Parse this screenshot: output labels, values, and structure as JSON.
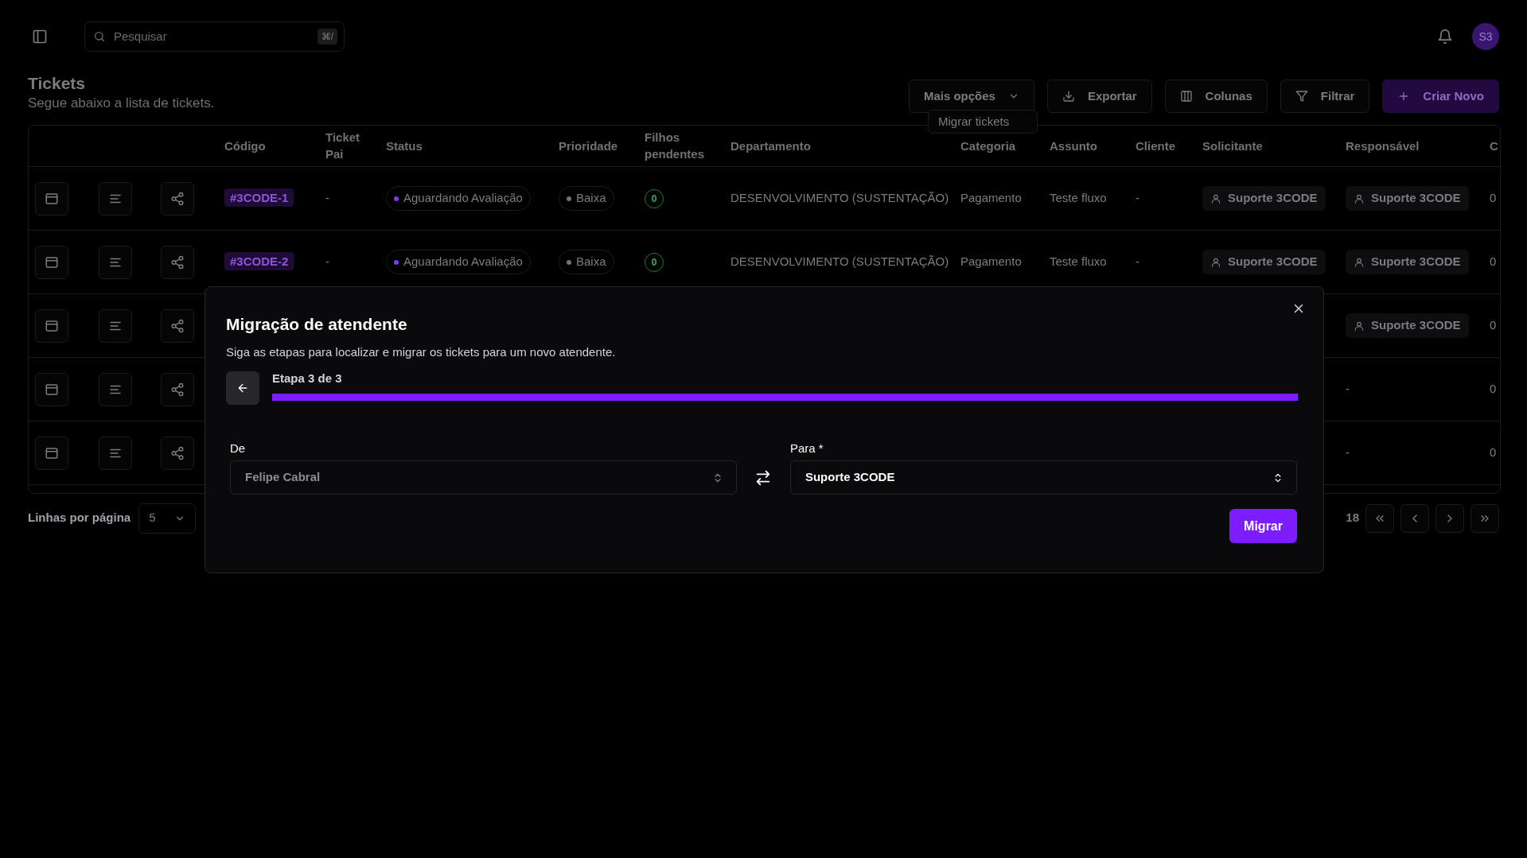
{
  "topbar": {
    "search": {
      "placeholder": "Pesquisar",
      "shortcut": "⌘/"
    },
    "avatar": "S3"
  },
  "header": {
    "title": "Tickets",
    "subtitle": "Segue abaixo a lista de tickets.",
    "buttons": [
      {
        "label": "Mais opções",
        "kind": "dropdown"
      },
      {
        "label": "Exportar",
        "kind": "export"
      },
      {
        "label": "Colunas",
        "kind": "columns"
      },
      {
        "label": "Filtrar",
        "kind": "filter"
      },
      {
        "label": "Criar Novo",
        "kind": "create"
      }
    ],
    "menu": [
      {
        "label": "Migrar tickets"
      }
    ]
  },
  "table": {
    "columns": [
      "Código",
      "Ticket Pai",
      "Status",
      "Prioridade",
      "Filhos pendentes",
      "Departamento",
      "Categoria",
      "Assunto",
      "Cliente",
      "Solicitante",
      "Responsável",
      "C"
    ],
    "rows": [
      {
        "cells": [
          {
            "kind": "code",
            "text": "#3CODE-1"
          },
          {
            "kind": "text",
            "text": "-"
          },
          {
            "kind": "status",
            "text": "Aguardando Avaliação",
            "color": "#7c3aed"
          },
          {
            "kind": "status",
            "text": "Baixa",
            "color": "#71717a"
          },
          {
            "kind": "count",
            "text": "0"
          },
          {
            "kind": "text",
            "text": "DESENVOLVIMENTO (SUSTENTAÇÃO)"
          },
          {
            "kind": "text",
            "text": "Pagamento"
          },
          {
            "kind": "text",
            "text": "Teste fluxo"
          },
          {
            "kind": "text",
            "text": "-"
          },
          {
            "kind": "person",
            "text": "Suporte 3CODE"
          },
          {
            "kind": "person",
            "text": "Suporte 3CODE"
          },
          {
            "kind": "text",
            "text": "0"
          }
        ]
      },
      {
        "cells": [
          {
            "kind": "code",
            "text": "#3CODE-2"
          },
          {
            "kind": "text",
            "text": "-"
          },
          {
            "kind": "status",
            "text": "Aguardando Avaliação",
            "color": "#7c3aed"
          },
          {
            "kind": "status",
            "text": "Baixa",
            "color": "#71717a"
          },
          {
            "kind": "count",
            "text": "0"
          },
          {
            "kind": "text",
            "text": "DESENVOLVIMENTO (SUSTENTAÇÃO)"
          },
          {
            "kind": "text",
            "text": "Pagamento"
          },
          {
            "kind": "text",
            "text": "Teste fluxo"
          },
          {
            "kind": "text",
            "text": "-"
          },
          {
            "kind": "person",
            "text": "Suporte 3CODE"
          },
          {
            "kind": "person",
            "text": "Suporte 3CODE"
          },
          {
            "kind": "text",
            "text": "0"
          }
        ]
      },
      {
        "cells": [
          null,
          null,
          null,
          null,
          null,
          null,
          null,
          null,
          null,
          null,
          {
            "kind": "person",
            "text": "Suporte 3CODE"
          },
          {
            "kind": "text",
            "text": "0"
          }
        ]
      },
      {
        "cells": [
          null,
          null,
          null,
          null,
          null,
          null,
          null,
          null,
          null,
          null,
          {
            "kind": "text",
            "text": "-"
          },
          {
            "kind": "text",
            "text": "0"
          }
        ]
      },
      {
        "cells": [
          null,
          null,
          null,
          null,
          null,
          null,
          null,
          null,
          null,
          null,
          {
            "kind": "text",
            "text": "-"
          },
          {
            "kind": "text",
            "text": "0"
          }
        ]
      }
    ]
  },
  "pagination": {
    "rows_label": "Linhas por página",
    "rows_value": "5",
    "page_text": "18"
  },
  "dialog": {
    "title": "Migração de atendente",
    "description": "Siga as etapas para localizar e migrar os tickets para um novo atendente.",
    "step": "Etapa 3 de 3",
    "level": 1,
    "from": {
      "label": "De",
      "value": "Felipe Cabral",
      "disabled": true
    },
    "to": {
      "label": "Para *",
      "value": "Suporte 3CODE",
      "disabled": false
    },
    "submit": "Migrar"
  }
}
